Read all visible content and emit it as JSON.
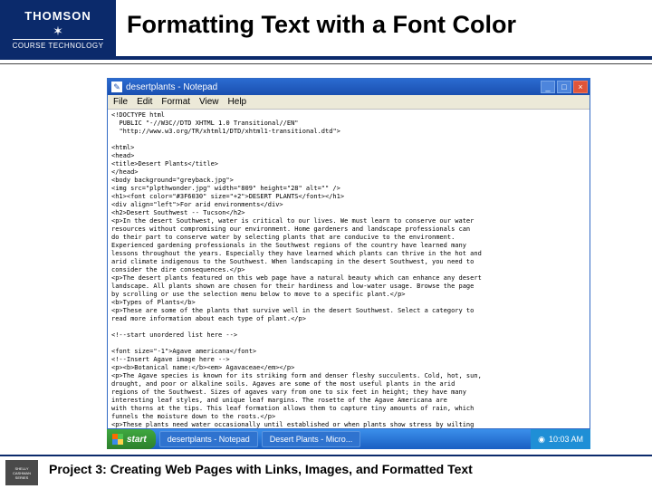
{
  "brand": {
    "thomson": "THOMSON",
    "course_tech": "COURSE TECHNOLOGY"
  },
  "slide_title": "Formatting Text with a Font Color",
  "notepad": {
    "title": "desertplants - Notepad",
    "menus": [
      "File",
      "Edit",
      "Format",
      "View",
      "Help"
    ],
    "code": "<!DOCTYPE html\n  PUBLIC \"-//W3C//DTD XHTML 1.0 Transitional//EN\"\n  \"http://www.w3.org/TR/xhtml1/DTD/xhtml1-transitional.dtd\">\n\n<html>\n<head>\n<title>Desert Plants</title>\n</head>\n<body background=\"greyback.jpg\">\n<img src=\"plpthwonder.jpg\" width=\"809\" height=\"28\" alt=\"\" />\n<h1><font color=\"#3F6030\" size=\"+2\">DESERT PLANTS</font></h1>\n<div align=\"left\">For arid environments</div>\n<h2>Desert Southwest -- Tucson</h2>\n<p>In the desert Southwest, water is critical to our lives. We must learn to conserve our water\nresources without compromising our environment. Home gardeners and landscape professionals can\ndo their part to conserve water by selecting plants that are conducive to the environment.\nExperienced gardening professionals in the Southwest regions of the country have learned many\nlessons throughout the years. Especially they have learned which plants can thrive in the hot and\narid climate indigenous to the Southwest. When landscaping in the desert Southwest, you need to\nconsider the dire consequences.</p>\n<p>The desert plants featured on this web page have a natural beauty which can enhance any desert\nlandscape. All plants shown are chosen for their hardiness and low-water usage. Browse the page\nby scrolling or use the selection menu below to move to a specific plant.</p>\n<b>Types of Plants</b>\n<p>These are some of the plants that survive well in the desert Southwest. Select a category to\nread more information about each type of plant.</p>\n\n<!--start unordered list here -->\n\n<font size=\"-1\">Agave americana</font>\n<!--Insert Agave image here -->\n<p><b>Botanical name:</b><em> Agavaceae</em></p>\n<p>The Agave species is known for its striking form and denser fleshy succulents. Cold, hot, sun,\ndrought, and poor or alkaline soils. Agaves are some of the most useful plants in the arid\nregions of the Southwest. Sizes of agaves vary from one to six feet in height; they have many\ninteresting leaf styles, and unique leaf margins. The rosette of the Agave Americana are\nwith thorns at the tips. This leaf formation allows them to capture tiny amounts of rain, which\nfunnels the moisture down to the roots.</p>\n<p>These plants need water occasionally until established or when plants show stress by wilting"
  },
  "taskbar": {
    "start": "start",
    "tasks": [
      "desertplants - Notepad",
      "Desert Plants - Micro..."
    ],
    "clock": "10:03 AM"
  },
  "footer": {
    "series_top": "SHELLY",
    "series_mid": "CASHMAN",
    "series_bot": "SERIES",
    "caption": "Project 3: Creating Web Pages with Links, Images, and Formatted Text"
  }
}
